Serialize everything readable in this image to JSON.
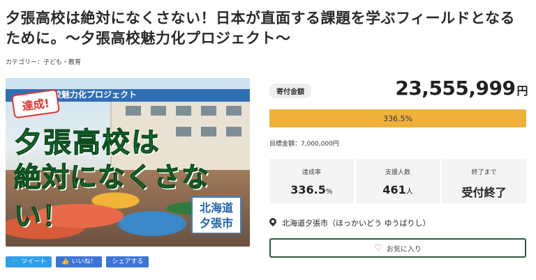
{
  "page": {
    "title": "夕張高校は絶対になくさない！日本が直面する課題を学ぶフィールドとなるために。〜夕張高校魅力化プロジェクト〜",
    "category_prefix": "カテゴリー：",
    "category_link": "子ども・教育"
  },
  "hero": {
    "badge": "達成!",
    "project": "高校魅力化プロジェクト",
    "headline_1": "夕張高校は",
    "headline_2": "絶対になくさない！",
    "place_line1": "北海道",
    "place_line2": "夕張市"
  },
  "social": {
    "tweet": "ツイート",
    "like": "いいね！",
    "share": "シェアする"
  },
  "funding": {
    "label": "寄付金額",
    "amount": "23,555,999",
    "currency": "円",
    "progress_percent": 336.5,
    "progress_text": "336.5%",
    "target_text": "目標金額：7,000,000円"
  },
  "stats": [
    {
      "label": "達成率",
      "value": "336.5",
      "unit": "%"
    },
    {
      "label": "支援人数",
      "value": "461",
      "unit": "人"
    },
    {
      "label": "終了まで",
      "value": "受付終了",
      "unit": ""
    }
  ],
  "location": "北海道夕張市（ほっかいどう ゆうばりし）",
  "favorite_label": "お気に入り",
  "colors": {
    "progress": "#efb13a",
    "favorite_border": "#2c5a3f",
    "heart": "#d9536f",
    "hero_text": "#1b8a3a"
  }
}
